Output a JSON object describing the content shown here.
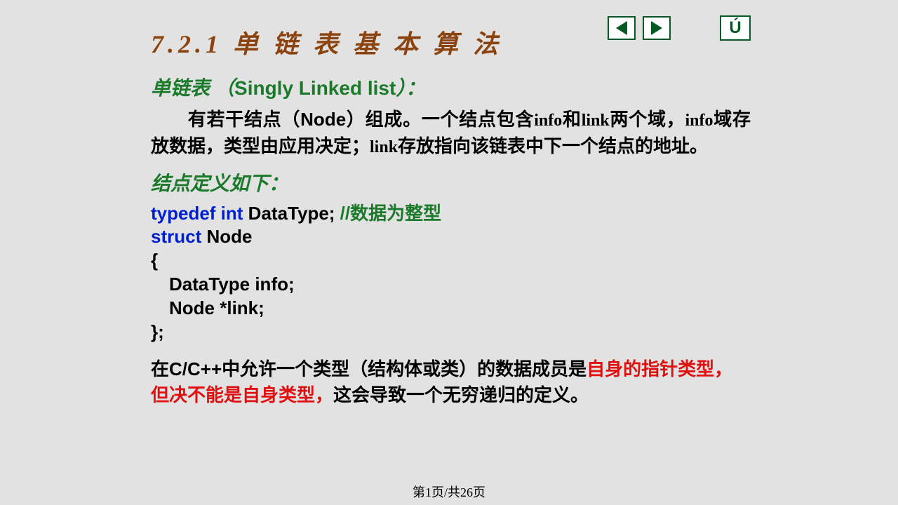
{
  "nav": {
    "prev_name": "prev-icon",
    "next_name": "next-icon",
    "back_glyph": "Ú"
  },
  "title": "7.2.1  单 链 表 基 本 算 法",
  "heading1_a": "单链表 （",
  "heading1_b": "Singly Linked list",
  "heading1_c": "）：",
  "para1_a": "有若干结点（",
  "para1_b": "Node",
  "para1_c": "）组成。一个结点包含",
  "para1_d": "info",
  "para1_e": "和",
  "para1_f": "link",
  "para1_g": "两个域，",
  "para1_h": "info",
  "para1_i": "域存放数据，类型由应用决定；",
  "para1_j": "link",
  "para1_k": "存放指向该链表中下一个结点的地址。",
  "heading2": "结点定义如下：",
  "code": {
    "l1a": "typedef int",
    "l1b": " DataType;  ",
    "l1c": "//数据为整型",
    "l2a": "struct",
    "l2b": " Node",
    "l3": "{",
    "l4": "DataType info;",
    "l5": "Node *link;",
    "l6": "};"
  },
  "bottom": {
    "t1": "在C/C++中允许一个类型（结构体或类）的数据成员是",
    "r1": "自身的指针类型，",
    "r2": "但决不能是自身类型，",
    "t2": "这会导致一个无穷递归的定义。"
  },
  "pager": "第1页/共26页"
}
